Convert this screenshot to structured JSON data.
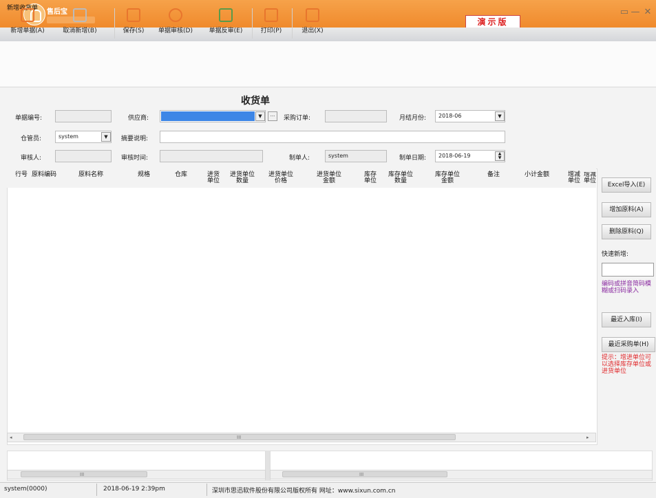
{
  "app": {
    "name": "售后宝",
    "trial": "演示版"
  },
  "window": {
    "caption": "新增收货单",
    "btn_min": "▭",
    "btn_minimize": "—",
    "btn_close": "✕"
  },
  "toolbar": {
    "new": "新增单据(A)",
    "cancel_new": "取消新增(B)",
    "save": "保存(S)",
    "audit": "单据审核(D)",
    "unaudit": "单据反审(E)",
    "print": "打印(P)",
    "exit": "退出(X)"
  },
  "form": {
    "title": "收货单",
    "doc_no_label": "单据编号:",
    "supplier_label": "供应商:",
    "supplier_more": "···",
    "purchase_order_label": "采购订单:",
    "month_label": "月结月份:",
    "month_value": "2018-06",
    "warehouse_keeper_label": "仓管员:",
    "warehouse_keeper_value": "system",
    "summary_label": "摘要说明:",
    "auditor_label": "审核人:",
    "audit_time_label": "审核时间:",
    "maker_label": "制单人:",
    "maker_value": "system",
    "make_date_label": "制单日期:",
    "make_date_value": "2018-06-19"
  },
  "grid": {
    "columns": [
      "行号",
      "原料编码",
      "原料名称",
      "规格",
      "仓库",
      "进货单位",
      "进货单位数量",
      "进货单位价格",
      "进货单位金额",
      "库存单位",
      "库存单位数量",
      "库存单位金额",
      "备注",
      "小计金额",
      "增减单位",
      "增减单位"
    ],
    "scroll_label": "III"
  },
  "side": {
    "excel_import": "Excel导入(E)",
    "add_material": "增加原料(A)",
    "delete_material": "删除原料(Q)",
    "quick_add_label": "快速新增:",
    "hint_purple": "编码或拼音简码模糊或扫码录入",
    "recent_in": "最近入库(I)",
    "recent_po": "最近采购单(H)",
    "hint_red": "提示：增进单位可以选择库存单位或进货单位"
  },
  "bottom": {
    "left_scroll": "III",
    "right_scroll": "III"
  },
  "status": {
    "user": "system(0000)",
    "datetime": "2018-06-19 2:39pm",
    "copyright": "深圳市思迅软件股份有限公司版权所有 网址：www.sixun.com.cn"
  }
}
